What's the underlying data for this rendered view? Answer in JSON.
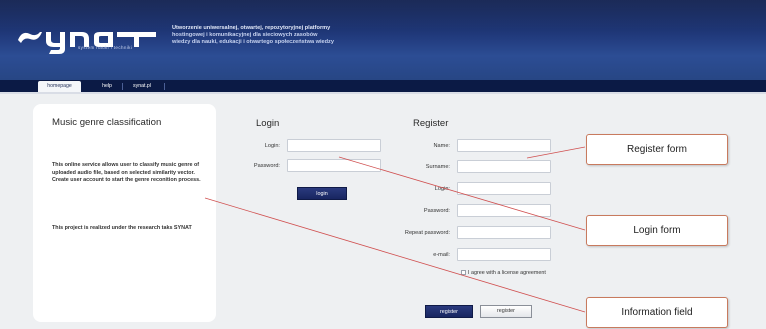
{
  "header": {
    "logo_text": "SYNAT",
    "logo_tagline": "system nauki i techniki",
    "description_lines": [
      "Utworzenie uniwersalnej, otwartej, repozytoryjnej platformy",
      "hostingowej i komunikacyjnej dla sieciowych zasobów",
      "wiedzy dla nauki, edukacji i otwartego społeczeństwa wiedzy"
    ]
  },
  "tabs": [
    {
      "label": "homepage",
      "active": true
    },
    {
      "label": "help",
      "active": false
    },
    {
      "label": "synat.pl",
      "active": false
    }
  ],
  "info": {
    "title": "Music genre classification",
    "paragraph1": "This online service allows user to classify music genre of uploaded audio file, based on selected similarity vector. Create user account to start the genre reconition process.",
    "paragraph2": "This project is realized under the research taks SYNAT"
  },
  "login": {
    "title": "Login",
    "login_label": "Login:",
    "password_label": "Password:",
    "login_value": "",
    "password_value": "",
    "button_label": "login"
  },
  "register": {
    "title": "Register",
    "fields": [
      {
        "label": "Name:",
        "value": ""
      },
      {
        "label": "Surname:",
        "value": ""
      },
      {
        "label": "Login:",
        "value": ""
      },
      {
        "label": "Password:",
        "value": ""
      },
      {
        "label": "Repeat password:",
        "value": ""
      },
      {
        "label": "e-mail:",
        "value": ""
      }
    ],
    "agree_label": "I agree with a license agreement",
    "agree_checked": false,
    "primary_button_label": "register",
    "secondary_button_label": "register"
  },
  "callouts": {
    "register_form": "Register form",
    "login_form": "Login form",
    "information_field": "Information field"
  },
  "colors": {
    "header_dark": "#0f1f4f",
    "header_mid": "#2c4d94",
    "tabbar": "#0b1a45",
    "button_dark": "#1f2d6e",
    "callout_line": "#d05050",
    "callout_border": "#c87a5e"
  }
}
